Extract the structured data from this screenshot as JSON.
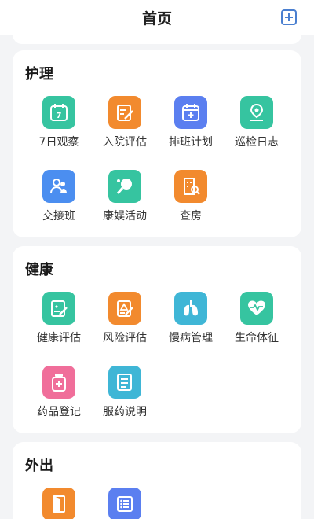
{
  "header": {
    "title": "首页",
    "add_icon": "add-square-icon"
  },
  "sections": [
    {
      "title": "护理",
      "items": [
        {
          "label": "7日观察",
          "icon": "calendar-7-icon",
          "color": "#36c4a0"
        },
        {
          "label": "入院评估",
          "icon": "clipboard-edit-icon",
          "color": "#f28a2e"
        },
        {
          "label": "排班计划",
          "icon": "calendar-plus-icon",
          "color": "#5b7ff0"
        },
        {
          "label": "巡检日志",
          "icon": "location-pin-icon",
          "color": "#36c4a0"
        },
        {
          "label": "交接班",
          "icon": "handover-users-icon",
          "color": "#4b8ef0"
        },
        {
          "label": "康娱活动",
          "icon": "ping-pong-icon",
          "color": "#36c4a0"
        },
        {
          "label": "查房",
          "icon": "building-search-icon",
          "color": "#f28a2e"
        }
      ]
    },
    {
      "title": "健康",
      "items": [
        {
          "label": "健康评估",
          "icon": "health-report-icon",
          "color": "#36c4a0"
        },
        {
          "label": "风险评估",
          "icon": "risk-report-icon",
          "color": "#f28a2e"
        },
        {
          "label": "慢病管理",
          "icon": "lungs-icon",
          "color": "#3fb6d6"
        },
        {
          "label": "生命体征",
          "icon": "heart-pulse-icon",
          "color": "#36c4a0"
        },
        {
          "label": "药品登记",
          "icon": "medicine-bottle-icon",
          "color": "#f06e9a"
        },
        {
          "label": "服药说明",
          "icon": "document-list-icon",
          "color": "#3fb6d6"
        }
      ]
    },
    {
      "title": "外出",
      "items": [
        {
          "label": "",
          "icon": "door-exit-icon",
          "color": "#f28a2e"
        },
        {
          "label": "",
          "icon": "list-icon",
          "color": "#5b7ff0"
        }
      ]
    }
  ]
}
